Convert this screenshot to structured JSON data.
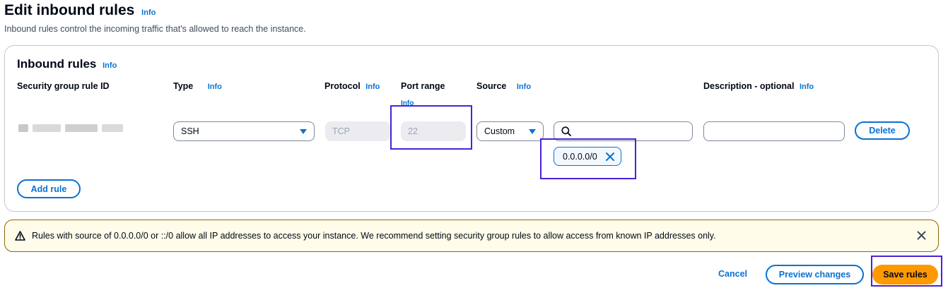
{
  "page": {
    "title": "Edit inbound rules",
    "info": "Info",
    "description": "Inbound rules control the incoming traffic that's allowed to reach the instance."
  },
  "panel": {
    "title": "Inbound rules",
    "info": "Info",
    "columns": {
      "rule_id": "Security group rule ID",
      "type": "Type",
      "protocol": "Protocol",
      "port_range": "Port range",
      "source": "Source",
      "description": "Description - optional"
    },
    "info_label": "Info"
  },
  "rule": {
    "type_value": "SSH",
    "protocol_value": "TCP",
    "port_range_value": "22",
    "source_type": "Custom",
    "source_search_value": "",
    "source_token": "0.0.0.0/0",
    "description_value": "",
    "delete_label": "Delete"
  },
  "add_rule_label": "Add rule",
  "alert": {
    "message": "Rules with source of 0.0.0.0/0 or ::/0 allow all IP addresses to access your instance. We recommend setting security group rules to allow access from known IP addresses only."
  },
  "footer": {
    "cancel_label": "Cancel",
    "preview_label": "Preview changes",
    "save_label": "Save rules"
  },
  "colors": {
    "link": "#0972d3",
    "primary": "#ff9900",
    "warning_border": "#8d6605",
    "warning_bg": "#fffce9",
    "highlight": "#4a22d6"
  },
  "icons": {
    "type_caret": "caret-down-icon",
    "source_caret": "caret-down-icon",
    "search": "search-icon",
    "token_remove": "close-icon",
    "warning": "warning-icon",
    "alert_close": "close-icon"
  }
}
